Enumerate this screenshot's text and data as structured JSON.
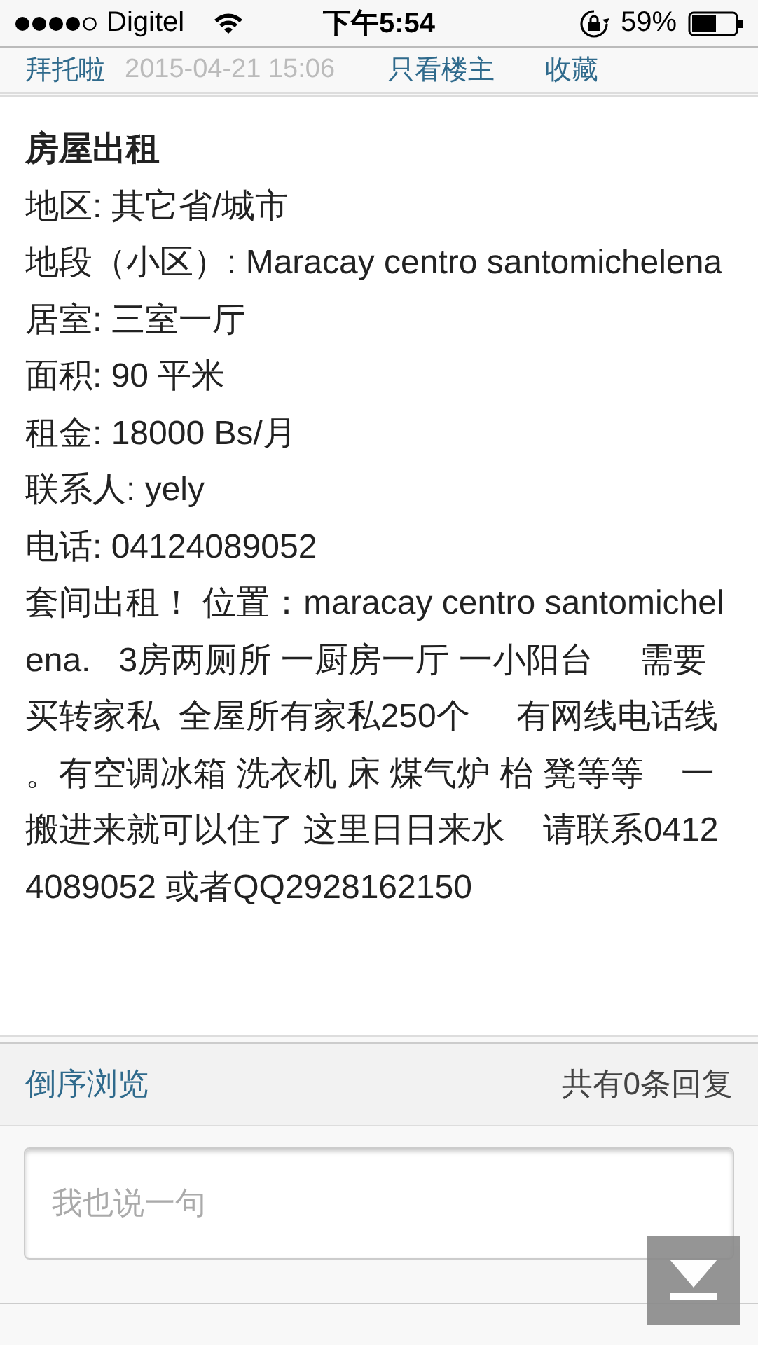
{
  "status_bar": {
    "carrier": "Digitel",
    "time": "下午5:54",
    "battery": "59%"
  },
  "post_meta": {
    "author": "拜托啦",
    "date": "2015-04-21 15:06",
    "links": [
      "只看楼主",
      "收藏"
    ]
  },
  "post": {
    "title": "房屋出租",
    "fields": [
      "地区: 其它省/城市",
      "地段（小区）: Maracay centro santomichelena",
      "居室: 三室一厅",
      "面积: 90 平米",
      "租金: 18000 Bs/月",
      "联系人: yely",
      "电话: 04124089052"
    ],
    "description": "套间出租！ 位置：maracay centro santomichelena.   3房两厕所 一厨房一厅 一小阳台     需要买转家私  全屋所有家私250个     有网线电话线。有空调冰箱 洗衣机 床 煤气炉 枱 凳等等    一搬进来就可以住了 这里日日来水    请联系0412 4089052 或者QQ2928162150"
  },
  "reply_bar": {
    "sort_link": "倒序浏览",
    "count": "共有0条回复"
  },
  "comment": {
    "placeholder": "我也说一句"
  }
}
